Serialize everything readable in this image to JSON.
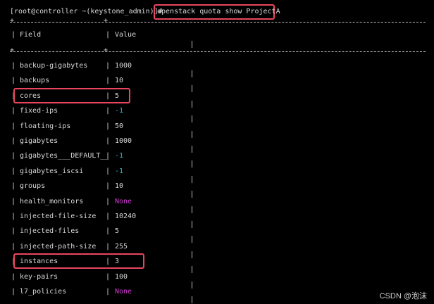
{
  "prompt": "[root@controller ~(keystone_admin)]#",
  "command": "openstack quota show ProjectA",
  "headers": {
    "field": "Field",
    "value": "Value"
  },
  "rows": [
    {
      "field": "backup-gigabytes",
      "value": "1000",
      "style": "normal",
      "highlighted": false
    },
    {
      "field": "backups",
      "value": "10",
      "style": "normal",
      "highlighted": false
    },
    {
      "field": "cores",
      "value": "5",
      "style": "normal",
      "highlighted": true
    },
    {
      "field": "fixed-ips",
      "value": "-1",
      "style": "cyan",
      "highlighted": false
    },
    {
      "field": "floating-ips",
      "value": "50",
      "style": "normal",
      "highlighted": false
    },
    {
      "field": "gigabytes",
      "value": "1000",
      "style": "normal",
      "highlighted": false
    },
    {
      "field": "gigabytes___DEFAULT__",
      "value": "-1",
      "style": "cyan",
      "highlighted": false
    },
    {
      "field": "gigabytes_iscsi",
      "value": "-1",
      "style": "cyan",
      "highlighted": false
    },
    {
      "field": "groups",
      "value": "10",
      "style": "normal",
      "highlighted": false
    },
    {
      "field": "health_monitors",
      "value": "None",
      "style": "magenta",
      "highlighted": false
    },
    {
      "field": "injected-file-size",
      "value": "10240",
      "style": "normal",
      "highlighted": false
    },
    {
      "field": "injected-files",
      "value": "5",
      "style": "normal",
      "highlighted": false
    },
    {
      "field": "injected-path-size",
      "value": "255",
      "style": "normal",
      "highlighted": false
    },
    {
      "field": "instances",
      "value": "3",
      "style": "normal",
      "highlighted": true
    },
    {
      "field": "key-pairs",
      "value": "100",
      "style": "normal",
      "highlighted": false
    },
    {
      "field": "l7_policies",
      "value": "None",
      "style": "magenta",
      "highlighted": false
    }
  ],
  "watermark": "CSDN @泡沫",
  "colors": {
    "background": "#000000",
    "text": "#d8d8d8",
    "cyan": "#2fb7c9",
    "magenta": "#d13ad6",
    "highlight": "#e8465f"
  }
}
